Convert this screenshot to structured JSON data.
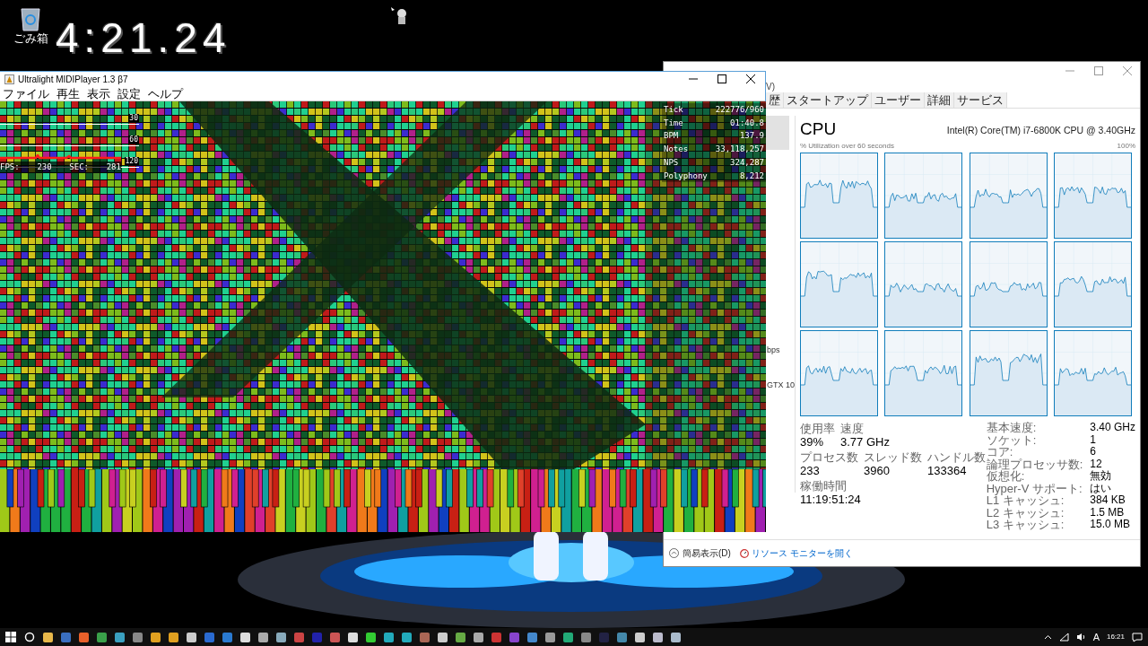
{
  "desktop": {
    "clock": "4:21.24",
    "icons": [
      {
        "label": "ごみ箱"
      }
    ]
  },
  "midi_player": {
    "title": "Ultralight MIDIPlayer 1.3 β7",
    "menu": [
      "ファイル",
      "再生",
      "表示",
      "設定",
      "ヘルプ"
    ],
    "stats": [
      {
        "label": "Tick",
        "value": "222776/960"
      },
      {
        "label": "Time",
        "value": "01:40.8"
      },
      {
        "label": "BPM",
        "value": "137.9"
      },
      {
        "label": "Notes",
        "value": "33,118,257"
      },
      {
        "label": "NPS",
        "value": "324,287"
      },
      {
        "label": "Polyphony",
        "value": "8,212"
      }
    ],
    "graph_labels": [
      "30",
      "60",
      "120"
    ],
    "fps_label": "FPS:",
    "fps": "230",
    "sec_label": "SEC:",
    "sec": "281"
  },
  "task_manager": {
    "menu_fragment": "V)",
    "tabs": [
      {
        "label": "歴",
        "selected": false
      },
      {
        "label": "スタートアップ",
        "selected": false
      },
      {
        "label": "ユーザー",
        "selected": false
      },
      {
        "label": "詳細",
        "selected": false
      },
      {
        "label": "サービス",
        "selected": false
      }
    ],
    "side_fragments": [
      "bps",
      "GTX 10"
    ],
    "heading": "CPU",
    "cpu_name": "Intel(R) Core(TM) i7-6800K CPU @ 3.40GHz",
    "graph_caption": "% Utilization over 60 seconds",
    "graph_max": "100%",
    "stat_rows": [
      [
        {
          "label": "使用率",
          "value": "39%"
        },
        {
          "label": "速度",
          "value": "3.77 GHz"
        }
      ],
      [
        {
          "label": "プロセス数",
          "value": "233"
        },
        {
          "label": "スレッド数",
          "value": "3960"
        },
        {
          "label": "ハンドル数",
          "value": "133364"
        }
      ],
      [
        {
          "label": "稼働時間",
          "value": "11:19:51:24"
        }
      ]
    ],
    "details": [
      {
        "label": "基本速度:",
        "value": "3.40 GHz"
      },
      {
        "label": "ソケット:",
        "value": "1"
      },
      {
        "label": "コア:",
        "value": "6"
      },
      {
        "label": "論理プロセッサ数:",
        "value": "12"
      },
      {
        "label": "仮想化:",
        "value": "無効"
      },
      {
        "label": "Hyper-V サポート:",
        "value": "はい"
      },
      {
        "label": "L1 キャッシュ:",
        "value": "384 KB"
      },
      {
        "label": "L2 キャッシュ:",
        "value": "1.5 MB"
      },
      {
        "label": "L3 キャッシュ:",
        "value": "15.0 MB"
      }
    ],
    "fewer_details": "簡易表示(D)",
    "resource_monitor": "リソース モニターを開く"
  },
  "taskbar": {
    "time": "16:21",
    "ime": "A"
  }
}
